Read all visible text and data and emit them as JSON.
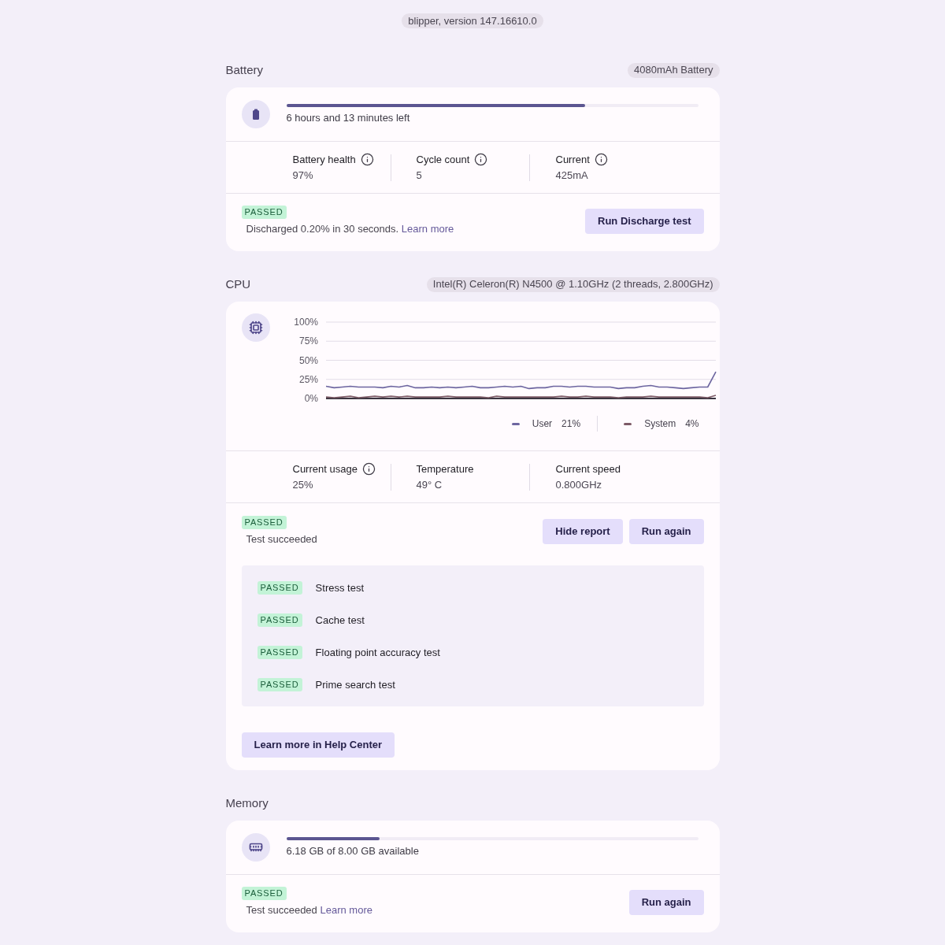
{
  "version_pill": "blipper, version 147.16610.0",
  "sections": [
    {
      "kind": "battery",
      "title": "Battery",
      "chip": "4080mAh Battery",
      "progress": {
        "level": 0.725,
        "caption": "6 hours and 13 minutes left"
      },
      "stats": [
        {
          "label": "Battery health",
          "value": "97%",
          "info": true
        },
        {
          "label": "Cycle count",
          "value": "5",
          "info": true
        },
        {
          "label": "Current",
          "value": "425mA",
          "info": true
        }
      ],
      "status": {
        "badge": "PASSED",
        "message": "Discharged 0.20% in 30 seconds.",
        "link": "Learn more"
      },
      "buttons": [
        "Run Discharge test"
      ]
    },
    {
      "kind": "cpu",
      "title": "CPU",
      "chip": "Intel(R) Celeron(R) N4500 @ 1.10GHz (2 threads, 2.800GHz)",
      "chart_data": {
        "type": "line",
        "grid": true,
        "ylim": [
          0,
          100
        ],
        "yticks": [
          {
            "value": 100,
            "label": "100%"
          },
          {
            "value": 75,
            "label": "75%"
          },
          {
            "value": 50,
            "label": "50%"
          },
          {
            "value": 25,
            "label": "25%"
          },
          {
            "value": 0,
            "label": "0%"
          }
        ],
        "series": [
          {
            "name": "User",
            "color": "#6d66a0",
            "values": [
              16,
              14,
              15,
              16,
              15,
              15,
              15,
              14,
              16,
              15,
              17,
              14,
              14,
              15,
              14,
              15,
              14,
              15,
              16,
              14,
              14,
              15,
              16,
              15,
              16,
              13,
              14,
              14,
              16,
              16,
              15,
              16,
              16,
              15,
              15,
              15,
              13,
              14,
              14,
              16,
              17,
              15,
              15,
              14,
              13,
              14,
              15,
              15,
              35
            ]
          },
          {
            "name": "System",
            "color": "#7d5a66",
            "values": [
              2,
              1,
              2,
              3,
              1,
              2,
              3,
              2,
              3,
              2,
              3,
              2,
              2,
              2,
              2,
              3,
              2,
              2,
              2,
              2,
              1,
              3,
              2,
              2,
              2,
              2,
              2,
              2,
              2,
              3,
              2,
              2,
              3,
              2,
              2,
              2,
              1,
              2,
              2,
              2,
              3,
              2,
              2,
              2,
              2,
              2,
              2,
              1,
              4
            ]
          }
        ]
      },
      "legend": [
        {
          "reading": "21%"
        },
        {
          "reading": "4%"
        }
      ],
      "stats": [
        {
          "label": "Current usage",
          "value": "25%",
          "info": true
        },
        {
          "label": "Temperature",
          "value": "49° C",
          "info": false
        },
        {
          "label": "Current speed",
          "value": "0.800GHz",
          "info": false
        }
      ],
      "status": {
        "badge": "PASSED",
        "message": "Test succeeded"
      },
      "buttons": [
        "Hide report",
        "Run again"
      ],
      "report": [
        {
          "badge": "PASSED",
          "name": "Stress test"
        },
        {
          "badge": "PASSED",
          "name": "Cache test"
        },
        {
          "badge": "PASSED",
          "name": "Floating point accuracy test"
        },
        {
          "badge": "PASSED",
          "name": "Prime search test"
        }
      ],
      "help_button": "Learn more in Help Center"
    },
    {
      "kind": "memory",
      "title": "Memory",
      "progress": {
        "level": 0.2275,
        "caption": "6.18 GB of 8.00 GB available"
      },
      "status": {
        "badge": "PASSED",
        "message": "Test succeeded",
        "link": "Learn more"
      },
      "buttons": [
        "Run again"
      ]
    }
  ]
}
